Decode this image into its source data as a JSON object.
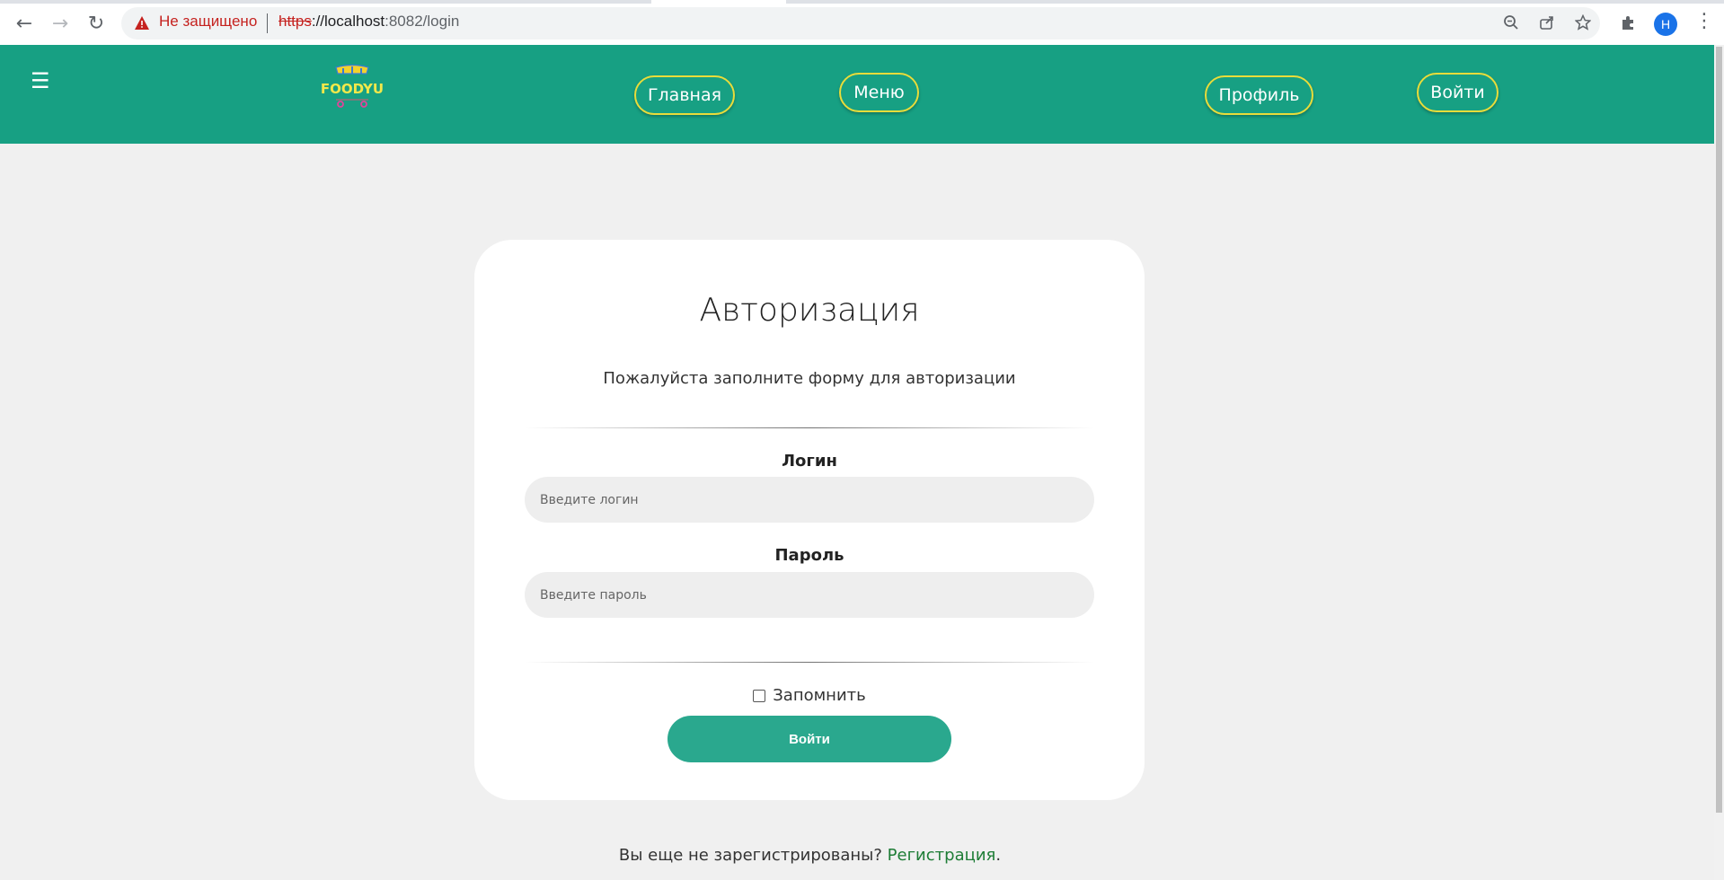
{
  "browser": {
    "security_label": "Не защищено",
    "url_scheme": "https",
    "url_host": "://localhost",
    "url_path": ":8082/login",
    "profile_initial": "Н"
  },
  "header": {
    "menu_icon": "☰",
    "logo_text": "FOODYU",
    "nav": {
      "home": "Главная",
      "menu": "Меню",
      "profile": "Профиль",
      "login": "Войти"
    },
    "colors": {
      "background": "#17a083",
      "pill_border": "#e9dc3a"
    }
  },
  "auth_card": {
    "title": "Авторизация",
    "subtitle": "Пожалуйста заполните форму для авторизации",
    "login_label": "Логин",
    "login_placeholder": "Введите логин",
    "password_label": "Пароль",
    "password_placeholder": "Введите пароль",
    "remember_label": "Запомнить",
    "submit_label": "Войти"
  },
  "footer": {
    "question": "Вы еще не зарегистрированы?",
    "register_link": "Регистрация",
    "period": "."
  }
}
